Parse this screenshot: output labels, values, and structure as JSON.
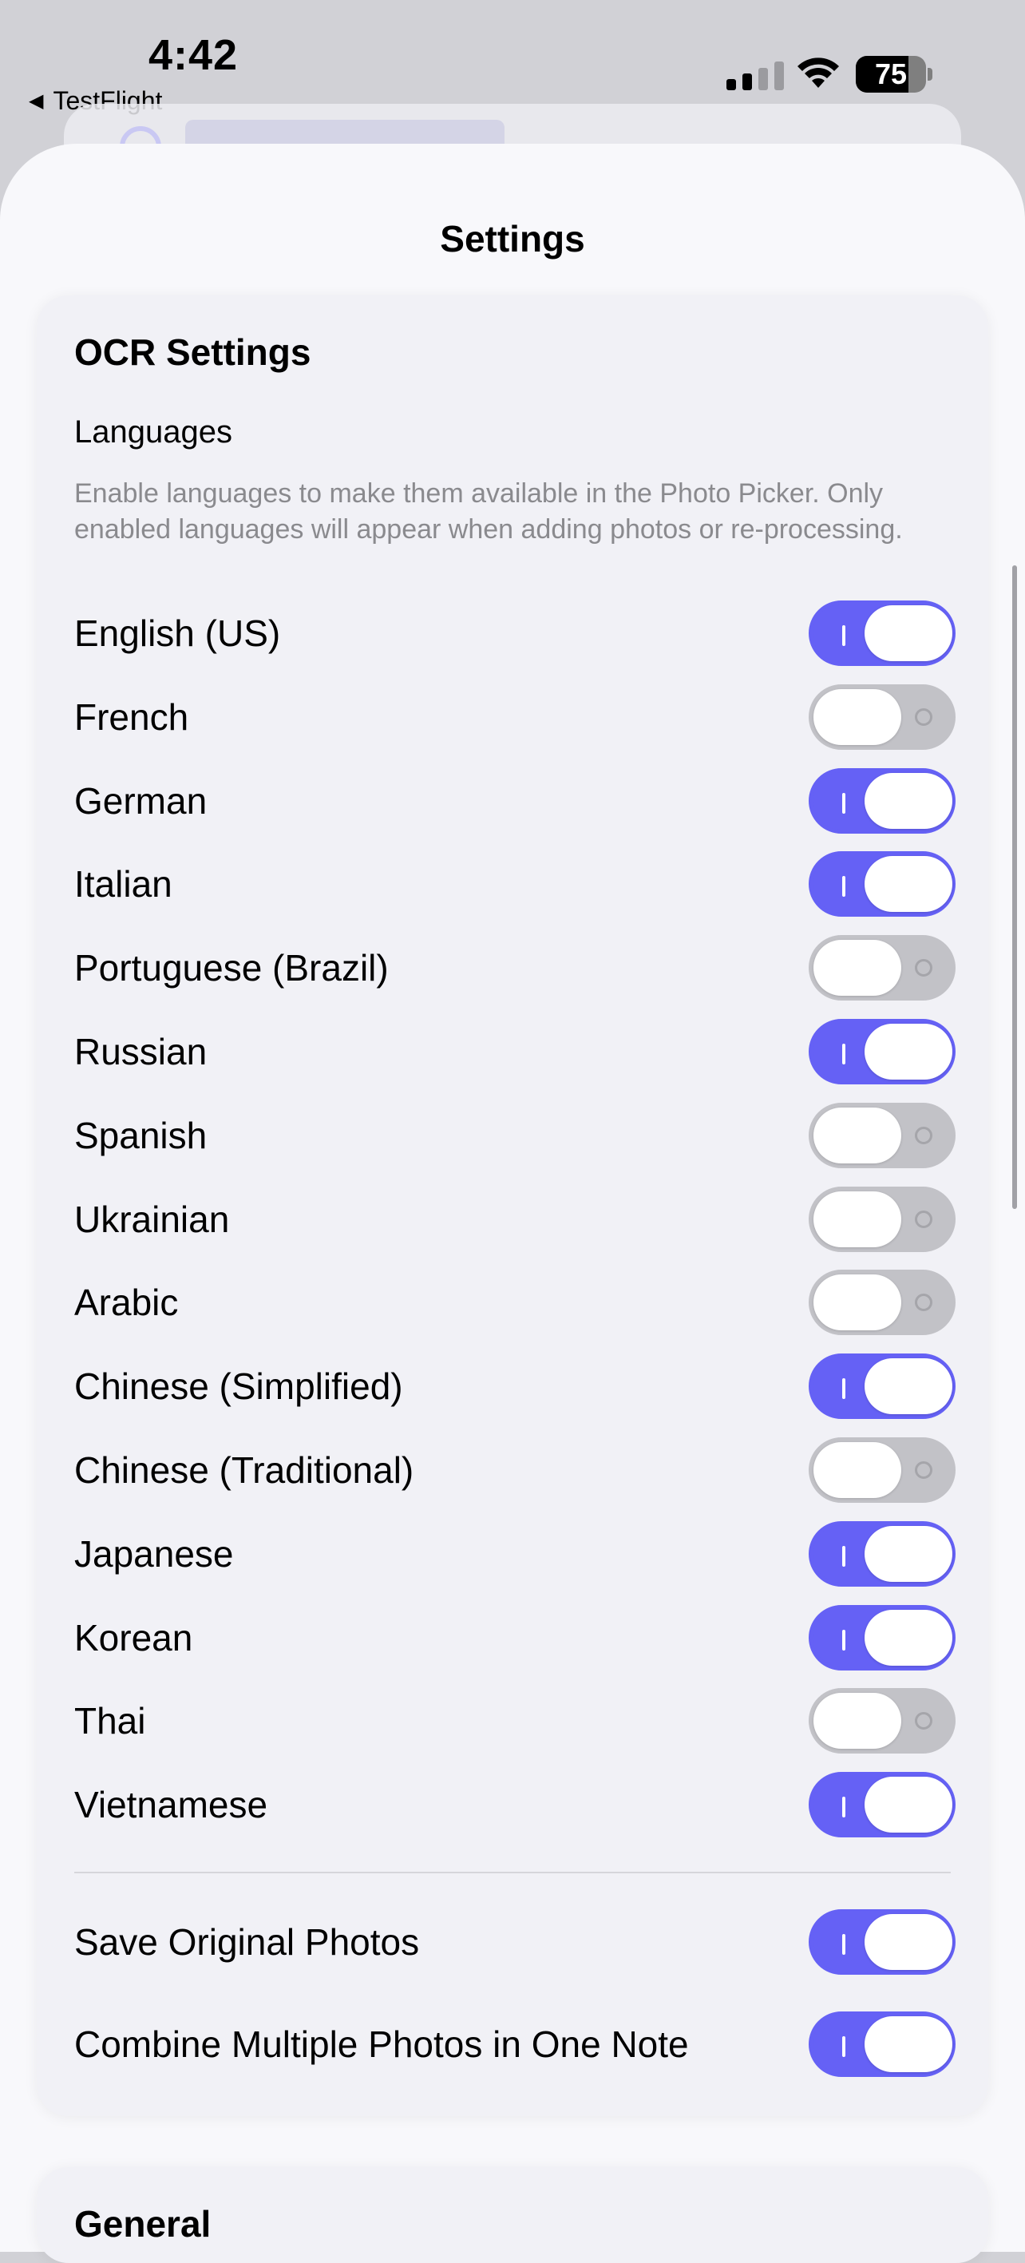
{
  "status_bar": {
    "time": "4:42",
    "back_app": "TestFlight",
    "battery": "75",
    "battery_level": 0.75
  },
  "sheet": {
    "title": "Settings"
  },
  "ocr": {
    "section_title": "OCR Settings",
    "languages_title": "Languages",
    "languages_desc": "Enable languages to make them available in the Photo Picker. Only enabled languages will appear when adding photos or re-processing.",
    "languages": [
      {
        "label": "English (US)",
        "on": true
      },
      {
        "label": "French",
        "on": false
      },
      {
        "label": "German",
        "on": true
      },
      {
        "label": "Italian",
        "on": true
      },
      {
        "label": "Portuguese (Brazil)",
        "on": false
      },
      {
        "label": "Russian",
        "on": true
      },
      {
        "label": "Spanish",
        "on": false
      },
      {
        "label": "Ukrainian",
        "on": false
      },
      {
        "label": "Arabic",
        "on": false
      },
      {
        "label": "Chinese (Simplified)",
        "on": true
      },
      {
        "label": "Chinese (Traditional)",
        "on": false
      },
      {
        "label": "Japanese",
        "on": true
      },
      {
        "label": "Korean",
        "on": true
      },
      {
        "label": "Thai",
        "on": false
      },
      {
        "label": "Vietnamese",
        "on": true
      }
    ],
    "options": [
      {
        "label": "Save Original Photos",
        "on": true
      },
      {
        "label": "Combine Multiple Photos in One Note",
        "on": true
      }
    ]
  },
  "next_section": {
    "title": "General"
  },
  "colors": {
    "accent": "#6561f5",
    "toggle_off": "#c2c2c7"
  }
}
